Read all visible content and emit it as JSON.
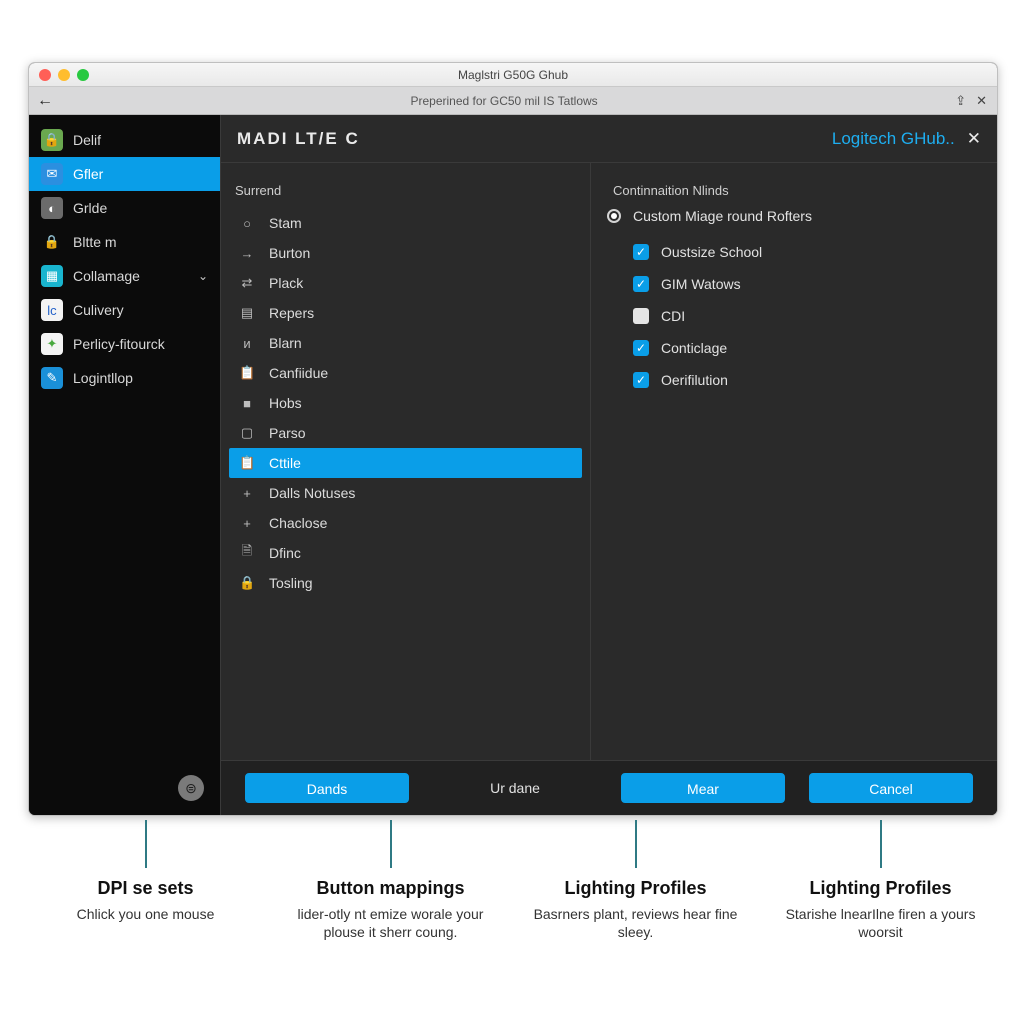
{
  "window": {
    "title": "Maglstri G50G Ghub",
    "subtitle": "Preperined for GC50 mil IS Tatlows",
    "brand": "Logitech GHub..",
    "page_title": "MADI LT/E C"
  },
  "sidebar": {
    "items": [
      {
        "label": "Delif",
        "icon_glyph": "🔒",
        "icon_class": "ic-green"
      },
      {
        "label": "Gfler",
        "icon_glyph": "✉",
        "icon_class": "ic-blue"
      },
      {
        "label": "Grlde",
        "icon_glyph": "◐",
        "icon_class": "ic-gray"
      },
      {
        "label": "Bltte m",
        "icon_glyph": "🔒",
        "icon_class": "ic-lock"
      },
      {
        "label": "Collamage",
        "icon_glyph": "▦",
        "icon_class": "ic-teal",
        "chevron": "⌄"
      },
      {
        "label": "Culivery",
        "icon_glyph": "lc",
        "icon_class": "ic-white"
      },
      {
        "label": "Perlicy-fitourck",
        "icon_glyph": "✦",
        "icon_class": "ic-lime"
      },
      {
        "label": "Logintllop",
        "icon_glyph": "✎",
        "icon_class": "ic-cyan"
      }
    ],
    "active_index": 1
  },
  "left_panel": {
    "heading": "Surrend",
    "items": [
      {
        "label": "Stam",
        "glyph": "○"
      },
      {
        "label": "Burton",
        "glyph": "→"
      },
      {
        "label": "Plack",
        "glyph": "⇄"
      },
      {
        "label": "Repers",
        "glyph": "▤"
      },
      {
        "label": "Blarn",
        "glyph": "ᴎ"
      },
      {
        "label": "Canfiidue",
        "glyph": "📋"
      },
      {
        "label": "Hobs",
        "glyph": "■"
      },
      {
        "label": "Parso",
        "glyph": "▢"
      },
      {
        "label": "Cttile",
        "glyph": "📋"
      },
      {
        "label": "Dalls Notuses",
        "glyph": "+"
      },
      {
        "label": "Chaclose",
        "glyph": "+"
      },
      {
        "label": "Dfinc",
        "glyph": "🗎"
      },
      {
        "label": "Tosling",
        "glyph": "🔒"
      }
    ],
    "selected_index": 8
  },
  "right_panel": {
    "heading": "Continnaition Nlinds",
    "radio_label": "Custom Miage round Rofters",
    "checks": [
      {
        "label": "Oustsize School",
        "checked": true
      },
      {
        "label": "GIM Watows",
        "checked": true
      },
      {
        "label": "CDI",
        "checked": false
      },
      {
        "label": "Conticlage",
        "checked": true
      },
      {
        "label": "Oerifilution",
        "checked": true
      }
    ]
  },
  "footer": {
    "dands": "Dands",
    "urdane": "Ur dane",
    "mear": "Mear",
    "cancel": "Cancel"
  },
  "callouts": [
    {
      "title": "DPI se sets",
      "body": "Chlick you one mouse"
    },
    {
      "title": "Button mappings",
      "body": "lider-otly nt emize worale your plouse it sherr coung."
    },
    {
      "title": "Lighting Profiles",
      "body": "Basrners plant, reviews hear fine sleey."
    },
    {
      "title": "Lighting Profiles",
      "body": "Starishe lnearIlne firen a yours woorsit"
    }
  ]
}
